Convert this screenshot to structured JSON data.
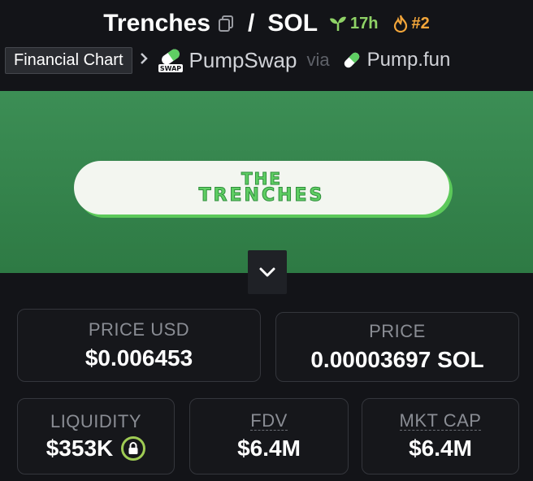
{
  "header": {
    "pair_base": "Trenches",
    "separator": "/",
    "pair_quote": "SOL",
    "age": "17h",
    "rank": "#2"
  },
  "breadcrumb": {
    "tooltip": "Financial Chart",
    "dex_badge": "SWAP",
    "dex_name": "PumpSwap",
    "via": "via",
    "launchpad": "Pump.fun"
  },
  "banner": {
    "line1": "THE",
    "line2": "TRENCHES"
  },
  "stats": {
    "price_usd": {
      "label": "PRICE USD",
      "value": "$0.006453"
    },
    "price": {
      "label": "PRICE",
      "value": "0.00003697 SOL"
    },
    "liquidity": {
      "label": "LIQUIDITY",
      "value": "$353K"
    },
    "fdv": {
      "label": "FDV",
      "value": "$6.4M"
    },
    "mkt_cap": {
      "label": "MKT CAP",
      "value": "$6.4M"
    }
  },
  "colors": {
    "background": "#131418",
    "banner_green": "#358550",
    "age_green": "#8fd266",
    "rank_orange": "#f3a63a",
    "lock_green": "#9fcb54"
  },
  "icons": [
    "copy-icon",
    "sprout-icon",
    "flame-icon",
    "chevron-right-icon",
    "pumpswap-logo",
    "pill-icon",
    "chevron-down-icon",
    "lock-icon"
  ]
}
